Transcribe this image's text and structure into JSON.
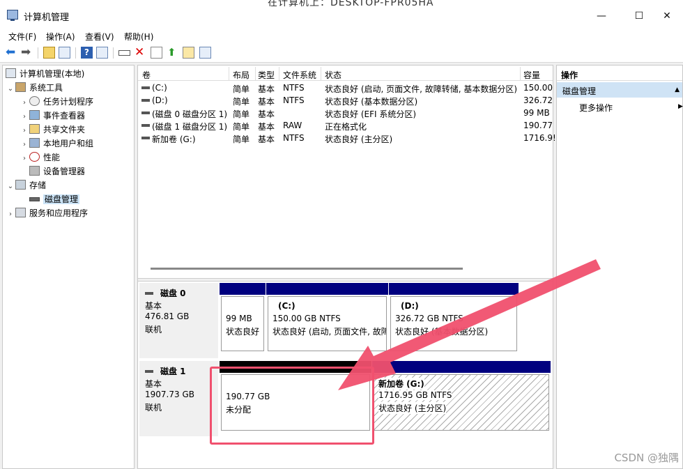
{
  "window": {
    "title": "计算机管理",
    "overlay_text": "在计算机上：DESKTOP-FPR05HA",
    "controls": [
      "—",
      "☐",
      "✕"
    ]
  },
  "menu": [
    "文件(F)",
    "操作(A)",
    "查看(V)",
    "帮助(H)"
  ],
  "tree": [
    {
      "label": "计算机管理(本地)",
      "icon": "computer-management-icon"
    },
    {
      "label": "系统工具",
      "icon": "tools-icon"
    },
    {
      "label": "任务计划程序",
      "icon": "clock-icon"
    },
    {
      "label": "事件查看器",
      "icon": "event-viewer-icon"
    },
    {
      "label": "共享文件夹",
      "icon": "shared-folder-icon"
    },
    {
      "label": "本地用户和组",
      "icon": "users-icon"
    },
    {
      "label": "性能",
      "icon": "performance-icon"
    },
    {
      "label": "设备管理器",
      "icon": "device-manager-icon"
    },
    {
      "label": "存储",
      "icon": "storage-icon"
    },
    {
      "label": "磁盘管理",
      "icon": "disk-icon"
    },
    {
      "label": "服务和应用程序",
      "icon": "services-icon"
    }
  ],
  "list": {
    "headers": [
      "卷",
      "布局",
      "类型",
      "文件系统",
      "状态",
      "容量"
    ],
    "rows": [
      {
        "vol": "(C:)",
        "layout": "简单",
        "type": "基本",
        "fs": "NTFS",
        "status": "状态良好 (启动, 页面文件, 故障转储, 基本数据分区)",
        "cap": "150.00"
      },
      {
        "vol": "(D:)",
        "layout": "简单",
        "type": "基本",
        "fs": "NTFS",
        "status": "状态良好 (基本数据分区)",
        "cap": "326.72"
      },
      {
        "vol": "(磁盘 0 磁盘分区 1)",
        "layout": "简单",
        "type": "基本",
        "fs": "",
        "status": "状态良好 (EFI 系统分区)",
        "cap": "99 MB"
      },
      {
        "vol": "(磁盘 1 磁盘分区 1)",
        "layout": "简单",
        "type": "基本",
        "fs": "RAW",
        "status": "正在格式化",
        "cap": "190.77"
      },
      {
        "vol": "新加卷 (G:)",
        "layout": "简单",
        "type": "基本",
        "fs": "NTFS",
        "status": "状态良好 (主分区)",
        "cap": "1716.9!"
      }
    ]
  },
  "disks": [
    {
      "name": "磁盘 0",
      "type": "基本",
      "size": "476.81 GB",
      "state": "联机",
      "parts": [
        {
          "title": "",
          "size": "99 MB",
          "status": "状态良好"
        },
        {
          "title": "(C:)",
          "size": "150.00 GB NTFS",
          "status": "状态良好 (启动, 页面文件, 故障"
        },
        {
          "title": "(D:)",
          "size": "326.72 GB NTFS",
          "status": "状态良好 (基本数据分区)"
        }
      ]
    },
    {
      "name": "磁盘 1",
      "type": "基本",
      "size": "1907.73 GB",
      "state": "联机",
      "parts": [
        {
          "title": "",
          "size": "190.77 GB",
          "status": "未分配"
        },
        {
          "title": "新加卷  (G:)",
          "size": "1716.95 GB NTFS",
          "status": "状态良好 (主分区)"
        }
      ]
    }
  ],
  "actions": {
    "header": "操作",
    "section": "磁盘管理",
    "more": "更多操作"
  },
  "watermark": "CSDN @独隅",
  "colors": {
    "partition_bar": "#00007f",
    "unallocated_bar": "#000000",
    "highlight": "#f0506e",
    "selection": "#cce4f7"
  }
}
